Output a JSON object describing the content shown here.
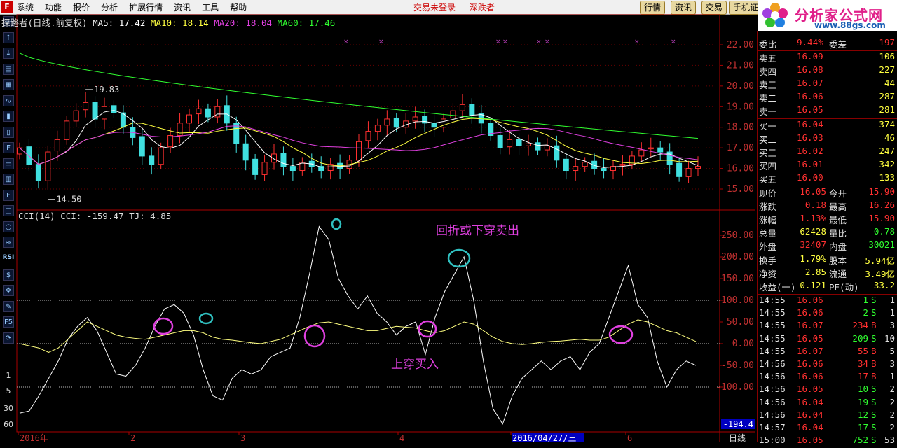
{
  "menu": {
    "logo": "F",
    "items": [
      "系统",
      "功能",
      "报价",
      "分析",
      "扩展行情",
      "资讯",
      "工具",
      "帮助"
    ],
    "center_items": [
      "交易未登录",
      "深跌者"
    ],
    "right_buttons": [
      "行情",
      "资讯",
      "交易",
      "手机证"
    ]
  },
  "brand": {
    "name": "分析家公式网",
    "url": "www.88gs.com",
    "code_overlay": "300005 探路者"
  },
  "left_toolbar": {
    "icon_names": [
      "cross-cursor-icon",
      "up-arrow-icon",
      "down-arrow-icon",
      "report-icon",
      "table-icon",
      "line-chart-icon",
      "candlestick-icon",
      "candles-icon",
      "f10-icon",
      "document-icon",
      "finance-icon",
      "f12-icon",
      "window-icon",
      "circle-icon",
      "indicator-icon",
      "rsi-icon",
      "money-icon",
      "move-icon",
      "pen-icon",
      "f5-icon",
      "refresh-icon"
    ],
    "labels": [
      "RSI",
      "1",
      "5",
      "30",
      "60"
    ]
  },
  "price_header": {
    "title": "探路者(日线.前复权)",
    "ma5_label": "MA5:",
    "ma5_value": "17.42",
    "ma10_label": "MA10:",
    "ma10_value": "18.14",
    "ma20_label": "MA20:",
    "ma20_value": "18.04",
    "ma60_label": "MA60:",
    "ma60_value": "17.46"
  },
  "price_axis": [
    "22.00",
    "21.00",
    "20.00",
    "19.00",
    "18.00",
    "17.00",
    "16.00",
    "15.00"
  ],
  "price_marks": {
    "high": "19.83",
    "low": "14.50"
  },
  "cci_header": {
    "title": "CCI(14)",
    "cci_label": "CCI:",
    "cci_value": "-159.47",
    "tj_label": "TJ:",
    "tj_value": "4.85"
  },
  "cci_axis": [
    "250.00",
    "200.00",
    "150.00",
    "100.00",
    "50.00",
    "0.00",
    "-50.00",
    "-100.00"
  ],
  "cci_current": "-194.4",
  "annotations": {
    "sell": "回折或下穿卖出",
    "buy": "上穿买入"
  },
  "date_axis": {
    "labels": [
      "2016年",
      "2",
      "3",
      "4",
      "2016/04/27/三",
      "6"
    ],
    "period": "日线"
  },
  "colors": {
    "up": "#ff3030",
    "down": "#40e0e0",
    "ma5": "#ffffff",
    "ma10": "#ffff40",
    "ma20": "#e040e0",
    "ma60": "#30ff30",
    "annotation": "#e040e0"
  },
  "chart_data": [
    {
      "type": "candlestick",
      "title": "探路者(日线.前复权)",
      "ylim": [
        15.0,
        22.0
      ],
      "high": 19.83,
      "low": 14.5,
      "closes": [
        17.0,
        16.2,
        15.4,
        16.8,
        17.4,
        18.3,
        18.8,
        19.2,
        18.4,
        19.0,
        18.7,
        18.0,
        17.5,
        16.6,
        16.2,
        17.0,
        17.6,
        18.2,
        18.6,
        18.9,
        18.5,
        19.0,
        18.2,
        17.2,
        16.4,
        15.7,
        16.3,
        16.7,
        16.1,
        15.9,
        16.3,
        16.1,
        15.9,
        16.2,
        16.0,
        16.4,
        17.3,
        17.8,
        18.1,
        18.4,
        18.0,
        18.3,
        18.5,
        18.2,
        18.0,
        18.4,
        18.8,
        19.1,
        18.6,
        18.2,
        17.6,
        17.0,
        17.4,
        17.1,
        17.2,
        16.9,
        17.1,
        16.4,
        15.9,
        16.1,
        16.3,
        16.0,
        15.9,
        16.1,
        16.2,
        16.6,
        16.9,
        17.0,
        16.8,
        16.2,
        15.6,
        16.0,
        16.1
      ],
      "ma5_last": 17.42,
      "ma10_last": 18.14,
      "ma20_last": 18.04,
      "ma60_last": 17.46
    },
    {
      "type": "line",
      "title": "CCI(14)",
      "ylim": [
        -194.4,
        280
      ],
      "series": [
        {
          "name": "CCI",
          "values": [
            -160,
            -155,
            -120,
            -80,
            -40,
            10,
            40,
            60,
            30,
            -20,
            -70,
            -75,
            -50,
            -10,
            40,
            80,
            90,
            70,
            20,
            -60,
            -120,
            -130,
            -80,
            -60,
            -70,
            -60,
            -30,
            -20,
            -10,
            60,
            160,
            270,
            240,
            150,
            110,
            80,
            110,
            70,
            50,
            20,
            40,
            50,
            -25,
            60,
            120,
            160,
            200,
            100,
            -40,
            -150,
            -185,
            -120,
            -80,
            -60,
            -40,
            -60,
            -40,
            -30,
            -60,
            -20,
            0,
            60,
            120,
            180,
            90,
            60,
            -40,
            -100,
            -60,
            -40,
            -50
          ]
        },
        {
          "name": "TJ",
          "values": [
            0,
            -5,
            -10,
            -20,
            -10,
            10,
            30,
            50,
            40,
            30,
            20,
            15,
            12,
            10,
            15,
            20,
            25,
            30,
            30,
            25,
            15,
            10,
            8,
            5,
            2,
            0,
            5,
            10,
            20,
            30,
            40,
            48,
            50,
            45,
            40,
            35,
            30,
            30,
            35,
            40,
            38,
            36,
            30,
            25,
            30,
            40,
            50,
            45,
            30,
            15,
            5,
            0,
            -2,
            0,
            3,
            5,
            6,
            8,
            10,
            8,
            8,
            15,
            30,
            45,
            55,
            50,
            40,
            30,
            25,
            15,
            5
          ]
        }
      ]
    }
  ],
  "sidepanel": {
    "top_row": {
      "label1": "委比",
      "value1": "9.44%",
      "label2": "委差",
      "value2": "197"
    },
    "sells": [
      {
        "label": "卖五",
        "price": "16.09",
        "vol": "106"
      },
      {
        "label": "卖四",
        "price": "16.08",
        "vol": "227"
      },
      {
        "label": "卖三",
        "price": "16.07",
        "vol": "44"
      },
      {
        "label": "卖二",
        "price": "16.06",
        "vol": "287"
      },
      {
        "label": "卖一",
        "price": "16.05",
        "vol": "281"
      }
    ],
    "buys": [
      {
        "label": "买一",
        "price": "16.04",
        "vol": "374"
      },
      {
        "label": "买二",
        "price": "16.03",
        "vol": "46"
      },
      {
        "label": "买三",
        "price": "16.02",
        "vol": "247"
      },
      {
        "label": "买四",
        "price": "16.01",
        "vol": "342"
      },
      {
        "label": "买五",
        "price": "16.00",
        "vol": "133"
      }
    ],
    "stats": [
      {
        "l1": "现价",
        "v1": "16.05",
        "l2": "今开",
        "v2": "15.90"
      },
      {
        "l1": "涨跌",
        "v1": "0.18",
        "l2": "最高",
        "v2": "16.26"
      },
      {
        "l1": "涨幅",
        "v1": "1.13%",
        "l2": "最低",
        "v2": "15.90"
      },
      {
        "l1": "总量",
        "v1": "62428",
        "l2": "量比",
        "v2": "0.78"
      },
      {
        "l1": "外盘",
        "v1": "32407",
        "l2": "内盘",
        "v2": "30021"
      }
    ],
    "stats2": [
      {
        "l1": "换手",
        "v1": "1.79%",
        "l2": "股本",
        "v2": "5.94亿"
      },
      {
        "l1": "净资",
        "v1": "2.85",
        "l2": "流通",
        "v2": "3.49亿"
      },
      {
        "l1": "收益(一)",
        "v1": "0.121",
        "l2": "PE(动)",
        "v2": "33.2"
      }
    ],
    "ticks": [
      {
        "time": "14:55",
        "price": "16.06",
        "vol": "1",
        "side": "S",
        "n": "1"
      },
      {
        "time": "14:55",
        "price": "16.06",
        "vol": "2",
        "side": "S",
        "n": "1"
      },
      {
        "time": "14:55",
        "price": "16.07",
        "vol": "234",
        "side": "B",
        "n": "3"
      },
      {
        "time": "14:55",
        "price": "16.05",
        "vol": "209",
        "side": "S",
        "n": "10"
      },
      {
        "time": "14:55",
        "price": "16.07",
        "vol": "55",
        "side": "B",
        "n": "5"
      },
      {
        "time": "14:56",
        "price": "16.06",
        "vol": "34",
        "side": "B",
        "n": "3"
      },
      {
        "time": "14:56",
        "price": "16.06",
        "vol": "17",
        "side": "B",
        "n": "1"
      },
      {
        "time": "14:56",
        "price": "16.05",
        "vol": "10",
        "side": "S",
        "n": "2"
      },
      {
        "time": "14:56",
        "price": "16.04",
        "vol": "19",
        "side": "S",
        "n": "2"
      },
      {
        "time": "14:56",
        "price": "16.04",
        "vol": "12",
        "side": "S",
        "n": "2"
      },
      {
        "time": "14:57",
        "price": "16.04",
        "vol": "17",
        "side": "S",
        "n": "2"
      },
      {
        "time": "15:00",
        "price": "16.05",
        "vol": "752",
        "side": "S",
        "n": "53"
      }
    ]
  }
}
